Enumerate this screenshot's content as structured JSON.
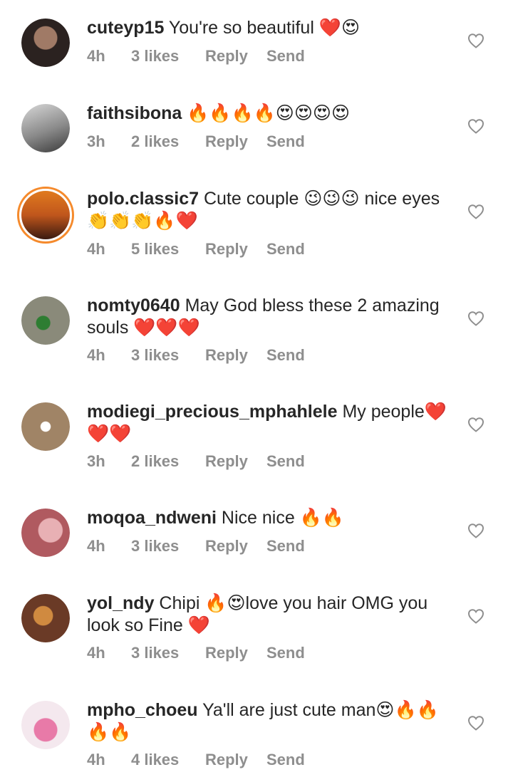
{
  "comments": [
    {
      "username": "cuteyp15",
      "text": " You're so beautiful ❤️😍",
      "time": "4h",
      "likes": "3 likes",
      "reply": "Reply",
      "send": "Send",
      "avatar_color": "#4a3a34",
      "ring": false
    },
    {
      "username": "faithsibona",
      "text": " 🔥🔥🔥🔥😍😍😍😍",
      "time": "3h",
      "likes": "2 likes",
      "reply": "Reply",
      "send": "Send",
      "avatar_color": "#9a9a9a",
      "ring": false
    },
    {
      "username": "polo.classic7",
      "text": " Cute couple 😉😉😉 nice eyes👏👏👏🔥❤️",
      "time": "4h",
      "likes": "5 likes",
      "reply": "Reply",
      "send": "Send",
      "avatar_color": "#c0561c",
      "ring": true
    },
    {
      "username": "nomty0640",
      "text": " May God bless these 2 amazing souls ❤️❤️❤️",
      "time": "4h",
      "likes": "3 likes",
      "reply": "Reply",
      "send": "Send",
      "avatar_color": "#7a8a6a",
      "ring": false
    },
    {
      "username": "modiegi_precious_mphahlele",
      "text": " My people❤️❤️❤️",
      "time": "3h",
      "likes": "2 likes",
      "reply": "Reply",
      "send": "Send",
      "avatar_color": "#a08466",
      "ring": false
    },
    {
      "username": "moqoa_ndweni",
      "text": " Nice nice 🔥🔥",
      "time": "4h",
      "likes": "3 likes",
      "reply": "Reply",
      "send": "Send",
      "avatar_color": "#c9868a",
      "ring": false
    },
    {
      "username": "yol_ndy",
      "text": " Chipi 🔥😍love you hair OMG you look so Fine ❤️",
      "time": "4h",
      "likes": "3 likes",
      "reply": "Reply",
      "send": "Send",
      "avatar_color": "#8a5030",
      "ring": false
    },
    {
      "username": "mpho_choeu",
      "text": " Ya'll are just cute man😍🔥🔥🔥🔥",
      "time": "4h",
      "likes": "4 likes",
      "reply": "Reply",
      "send": "Send",
      "avatar_color": "#e6a8c4",
      "ring": false
    }
  ],
  "icons": {
    "like": "heart-outline-icon"
  }
}
